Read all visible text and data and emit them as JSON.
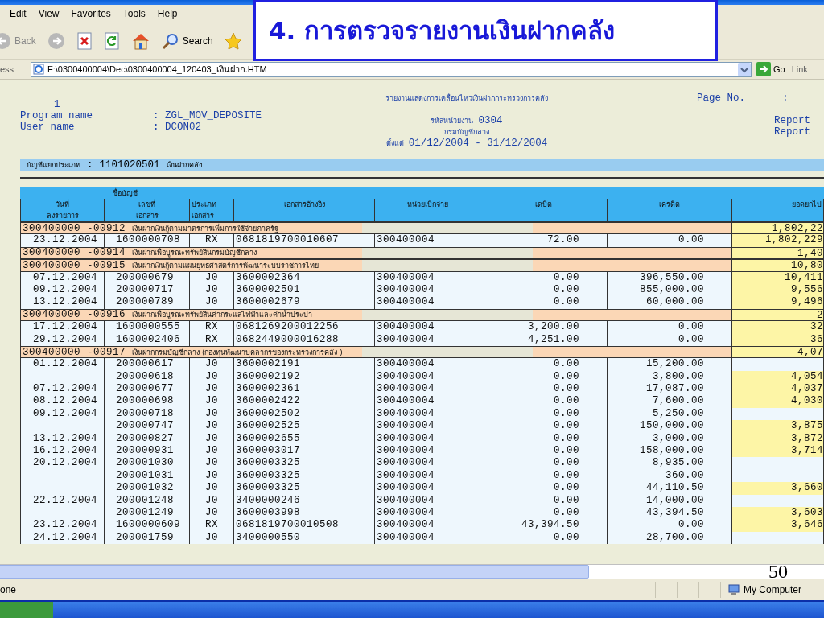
{
  "menu": [
    "Edit",
    "View",
    "Favorites",
    "Tools",
    "Help"
  ],
  "toolbar": [
    {
      "kind": "back",
      "label": "Back"
    },
    {
      "kind": "forward"
    },
    {
      "kind": "stop"
    },
    {
      "kind": "refresh"
    },
    {
      "kind": "home"
    },
    {
      "kind": "search",
      "label": "Search"
    },
    {
      "kind": "favorites"
    }
  ],
  "address": {
    "label": "ess",
    "value": "F:\\0300400004\\Dec\\0300400004_120403_เงินฝาก.HTM",
    "go": "Go",
    "links": "Link"
  },
  "slide_title": "4. การตรวจรายงานเงินฝากคลัง",
  "report": {
    "page_index": "1",
    "program_label": "Program name",
    "program_value": ": ZGL_MOV_DEPOSITE",
    "user_label": "User name",
    "user_value": ": DCON02",
    "title": "รายงานแสดงการเคลื่อนไหวเงินฝากกระทรวงการคลัง",
    "unit_label": "รหัสหน่วยงาน",
    "unit_value": "0304",
    "department": "กรมบัญชีกลาง",
    "period_label": "ตั้งแต่",
    "period_value": "01/12/2004 - 31/12/2004",
    "page_label": "Page No.",
    "page_colon": ":",
    "report_labels": [
      "Report",
      "Report"
    ]
  },
  "ledger": {
    "label": "บัญชีแยกประเภท",
    "colon": ":",
    "code": "1101020501",
    "name": "เงินฝากคลัง"
  },
  "table": {
    "account_header": "ชื่อบัญชี",
    "columns": [
      [
        "วันที่",
        "ลงรายการ"
      ],
      [
        "เลขที่",
        "เอกสาร"
      ],
      [
        "ประเภท",
        "เอกสาร"
      ],
      [
        "เอกสารอ้างอิง"
      ],
      [
        "หน่วยเบิกจ่าย"
      ],
      [
        "เดบิต"
      ],
      [
        "เครดิต"
      ],
      [
        "ยอดยกไป"
      ]
    ],
    "rows": [
      {
        "kind": "group",
        "code": "300400000 -00912",
        "name": "เงินฝากเงินกู้ตามมาตรการเพิ่มการใช้จ่ายภาครัฐ",
        "balance": "1,802,22"
      },
      {
        "kind": "entry",
        "cells": [
          "23.12.2004",
          "1600000708",
          "RX",
          "0681819700010607",
          "300400004",
          "72.00",
          "0.00",
          "1,802,229"
        ]
      },
      {
        "kind": "group",
        "code": "300400000 -00914",
        "name": "เงินฝากเพื่อบูรณะทรัพย์สินกรมบัญชีกลาง",
        "balance": "1,40"
      },
      {
        "kind": "group",
        "code": "300400000 -00915",
        "name": "เงินฝากเงินกู้ตามแผนยุทธศาสตร์การพัฒนาระบบราชการไทย",
        "balance": "10,80"
      },
      {
        "kind": "entry",
        "cells": [
          "07.12.2004",
          "200000679",
          "J0",
          "3600002364",
          "300400004",
          "0.00",
          "396,550.00",
          "10,411"
        ]
      },
      {
        "kind": "entry",
        "cells": [
          "09.12.2004",
          "200000717",
          "J0",
          "3600002501",
          "300400004",
          "0.00",
          "855,000.00",
          "9,556"
        ]
      },
      {
        "kind": "entry",
        "cells": [
          "13.12.2004",
          "200000789",
          "J0",
          "3600002679",
          "300400004",
          "0.00",
          "60,000.00",
          "9,496"
        ]
      },
      {
        "kind": "group",
        "code": "300400000 -00916",
        "name": "เงินฝากเพื่อบูรณะทรัพย์สินค่ากระแสไฟฟ้าและค่าน้ำประปา",
        "balance": "2"
      },
      {
        "kind": "entry",
        "cells": [
          "17.12.2004",
          "1600000555",
          "RX",
          "0681269200012256",
          "300400004",
          "3,200.00",
          "0.00",
          "32"
        ]
      },
      {
        "kind": "entry",
        "cells": [
          "29.12.2004",
          "1600002406",
          "RX",
          "0682449000016288",
          "300400004",
          "4,251.00",
          "0.00",
          "36"
        ]
      },
      {
        "kind": "group",
        "code": "300400000 -00917",
        "name": "เงินฝากกรมบัญชีกลาง (กองทุนพัฒนาบุคลากรของกระทรวงการคลัง )",
        "balance": "4,07"
      },
      {
        "kind": "entry",
        "cells": [
          "01.12.2004",
          "200000617",
          "J0",
          "3600002191",
          "300400004",
          "0.00",
          "15,200.00",
          ""
        ]
      },
      {
        "kind": "entry",
        "cells": [
          "",
          "200000618",
          "J0",
          "3600002192",
          "300400004",
          "0.00",
          "3,800.00",
          "4,054"
        ]
      },
      {
        "kind": "entry",
        "cells": [
          "07.12.2004",
          "200000677",
          "J0",
          "3600002361",
          "300400004",
          "0.00",
          "17,087.00",
          "4,037"
        ]
      },
      {
        "kind": "entry",
        "cells": [
          "08.12.2004",
          "200000698",
          "J0",
          "3600002422",
          "300400004",
          "0.00",
          "7,600.00",
          "4,030"
        ]
      },
      {
        "kind": "entry",
        "cells": [
          "09.12.2004",
          "200000718",
          "J0",
          "3600002502",
          "300400004",
          "0.00",
          "5,250.00",
          ""
        ]
      },
      {
        "kind": "entry",
        "cells": [
          "",
          "200000747",
          "J0",
          "3600002525",
          "300400004",
          "0.00",
          "150,000.00",
          "3,875"
        ]
      },
      {
        "kind": "entry",
        "cells": [
          "13.12.2004",
          "200000827",
          "J0",
          "3600002655",
          "300400004",
          "0.00",
          "3,000.00",
          "3,872"
        ]
      },
      {
        "kind": "entry",
        "cells": [
          "16.12.2004",
          "200000931",
          "J0",
          "3600003017",
          "300400004",
          "0.00",
          "158,000.00",
          "3,714"
        ]
      },
      {
        "kind": "entry",
        "cells": [
          "20.12.2004",
          "200001030",
          "J0",
          "3600003325",
          "300400004",
          "0.00",
          "8,935.00",
          ""
        ]
      },
      {
        "kind": "entry",
        "cells": [
          "",
          "200001031",
          "J0",
          "3600003325",
          "300400004",
          "0.00",
          "360.00",
          ""
        ]
      },
      {
        "kind": "entry",
        "cells": [
          "",
          "200001032",
          "J0",
          "3600003325",
          "300400004",
          "0.00",
          "44,110.50",
          "3,660"
        ]
      },
      {
        "kind": "entry",
        "cells": [
          "22.12.2004",
          "200001248",
          "J0",
          "3400000246",
          "300400004",
          "0.00",
          "14,000.00",
          ""
        ]
      },
      {
        "kind": "entry",
        "cells": [
          "",
          "200001249",
          "J0",
          "3600003998",
          "300400004",
          "0.00",
          "43,394.50",
          "3,603"
        ]
      },
      {
        "kind": "entry",
        "cells": [
          "23.12.2004",
          "1600000609",
          "RX",
          "0681819700010508",
          "300400004",
          "43,394.50",
          "0.00",
          "3,646"
        ]
      },
      {
        "kind": "entry",
        "cells": [
          "24.12.2004",
          "200001759",
          "J0",
          "3400000550",
          "300400004",
          "0.00",
          "28,700.00",
          ""
        ]
      }
    ]
  },
  "status_bar": {
    "text": "one",
    "zone": "My Computer"
  },
  "slide_number": "50"
}
